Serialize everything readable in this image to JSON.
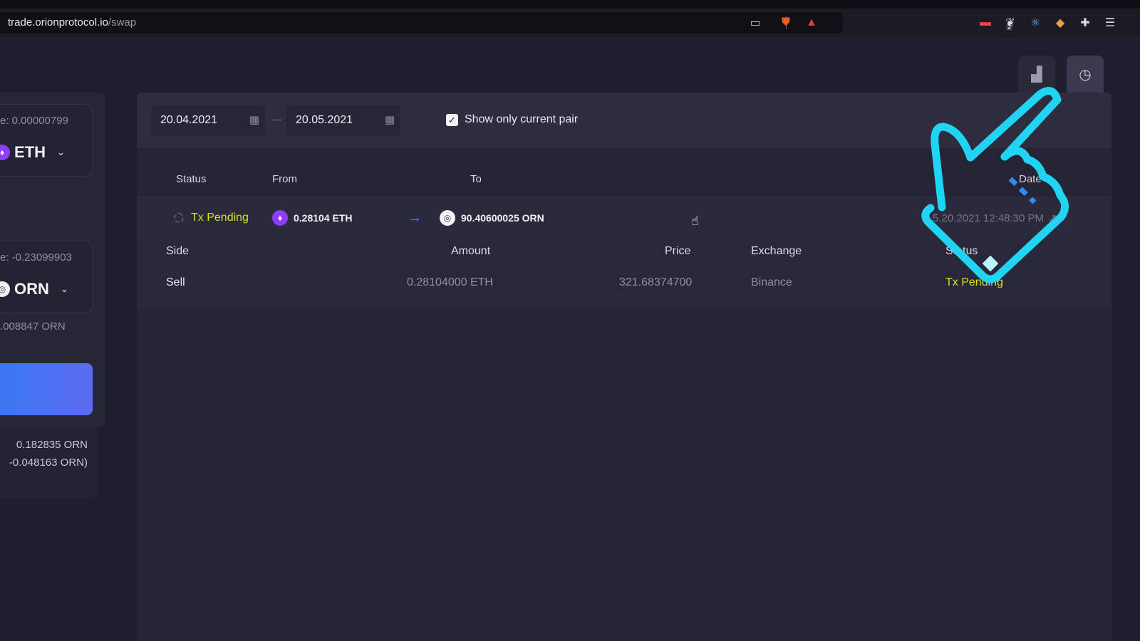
{
  "browser": {
    "url_host": "trade.orionprotocol.io",
    "url_path": "/swap",
    "extension_badge": "2"
  },
  "left_panel": {
    "from_balance": "e: 0.00000799",
    "from_token": "ETH",
    "to_balance": "e: -0.23099903",
    "to_token": "ORN",
    "to_amount": ".008847 ORN",
    "foot_line1": "0.182835 ORN",
    "foot_line2": "-0.048163 ORN)"
  },
  "filters": {
    "date_from": "20.04.2021",
    "date_to": "20.05.2021",
    "show_current_pair_label": "Show only current pair",
    "show_current_pair_checked": true
  },
  "history_table": {
    "columns": [
      "Status",
      "From",
      "To",
      "Date"
    ],
    "rows": [
      {
        "status": "Tx Pending",
        "from": "0.28104 ETH",
        "to": "90.40600025 ORN",
        "date": "5.20.2021 12:48:30 PM"
      }
    ]
  },
  "detail_table": {
    "columns": [
      "Side",
      "Amount",
      "Price",
      "Exchange",
      "Status"
    ],
    "rows": [
      {
        "side": "Sell",
        "amount": "0.28104000 ETH",
        "price": "321.68374700",
        "exchange": "Binance",
        "status": "Tx Pending"
      }
    ]
  },
  "icons": {
    "calendar": "calendar-icon",
    "stats_tab": "bar-chart-icon",
    "history_tab": "clock-icon",
    "eth": "ethereum-icon",
    "orn": "orion-icon"
  },
  "colors": {
    "pending": "#d8e021",
    "accent": "#4d8cf5",
    "eth": "#8e3dfc",
    "overlay_hand": "#21d4f2"
  }
}
